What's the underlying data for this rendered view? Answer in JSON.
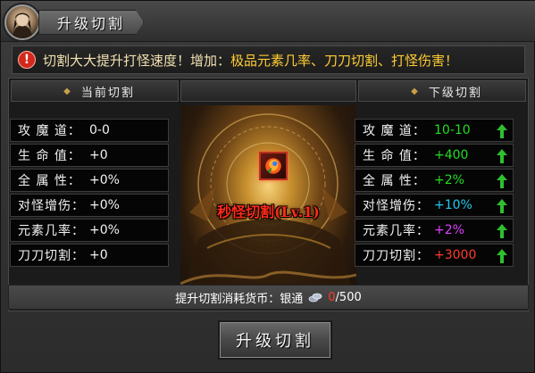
{
  "window": {
    "title": "升级切割"
  },
  "notice": {
    "prefix": "切割大大提升打怪速度！增加：",
    "highlight": "极品元素几率、刀刀切割、打怪伤害！"
  },
  "current": {
    "header": "当前切割",
    "stats": [
      {
        "label": "攻 魔 道：",
        "value": "0-0"
      },
      {
        "label": "生 命 值：",
        "value": "+0"
      },
      {
        "label": "全 属 性：",
        "value": "+0%"
      },
      {
        "label": "对怪增伤：",
        "value": "+0%"
      },
      {
        "label": "元素几率：",
        "value": "+0%"
      },
      {
        "label": "刀刀切割：",
        "value": "+0"
      }
    ]
  },
  "next": {
    "header": "下级切割",
    "stats": [
      {
        "label": "攻 魔 道：",
        "value": "10-10",
        "color": "#22dd22"
      },
      {
        "label": "生 命 值：",
        "value": "+400",
        "color": "#22dd22"
      },
      {
        "label": "全 属 性：",
        "value": "+2%",
        "color": "#22dd22"
      },
      {
        "label": "对怪增伤：",
        "value": "+10%",
        "color": "#22c8ee"
      },
      {
        "label": "元素几率：",
        "value": "+2%",
        "color": "#e040ff"
      },
      {
        "label": "刀刀切割：",
        "value": "+3000",
        "color": "#ff3b2b"
      }
    ]
  },
  "skill": {
    "name": "秒怪切割(Lv.1)"
  },
  "cost": {
    "label": "提升切割消耗货币：银通",
    "have": "0",
    "need": "/500"
  },
  "button": {
    "label": "升级切割"
  },
  "colors": {
    "up_arrow": "#2fbf2f",
    "skill_name": "#ff2a1a",
    "notice_highlight": "#ffcc33"
  }
}
